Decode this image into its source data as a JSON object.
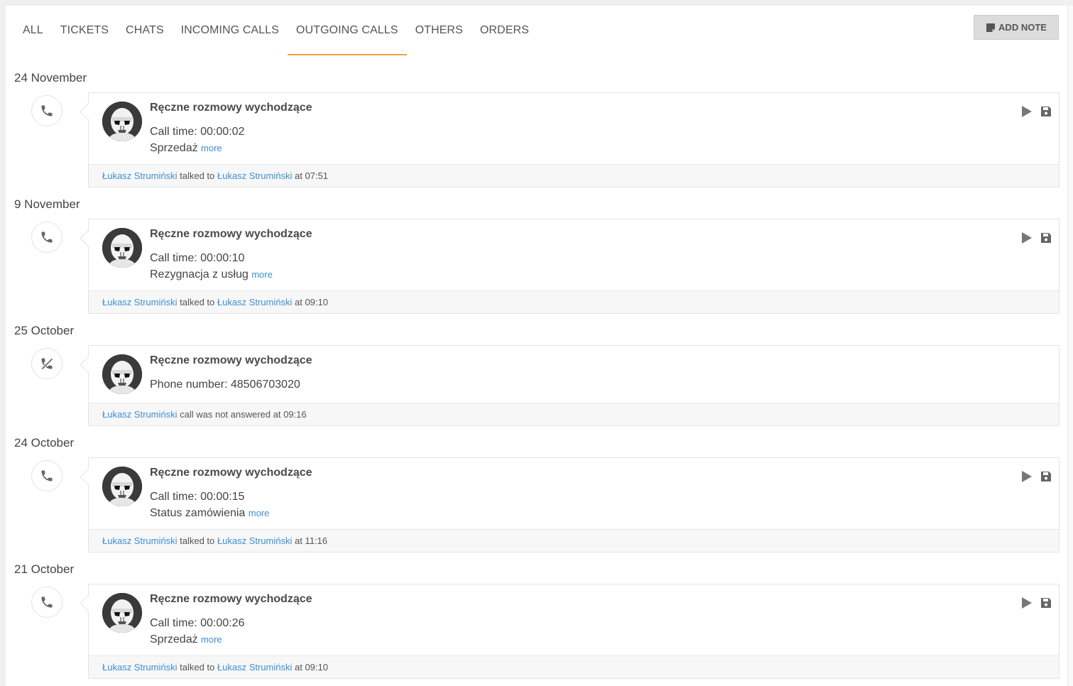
{
  "tabs": [
    {
      "label": "ALL",
      "active": false
    },
    {
      "label": "TICKETS",
      "active": false
    },
    {
      "label": "CHATS",
      "active": false
    },
    {
      "label": "INCOMING CALLS",
      "active": false
    },
    {
      "label": "OUTGOING CALLS",
      "active": true
    },
    {
      "label": "OTHERS",
      "active": false
    },
    {
      "label": "ORDERS",
      "active": false
    }
  ],
  "add_note_label": "ADD NOTE",
  "colors": {
    "accent_underline": "#e8a33d",
    "link": "#3d8fd6",
    "icon_gray": "#666666"
  },
  "entries": [
    {
      "date": "24 November",
      "icon": "phone-icon",
      "title": "Ręczne rozmowy wychodzące",
      "line1": "Call time: 00:00:02",
      "line2": "Sprzedaż",
      "more": "more",
      "answered": true,
      "agent": "Łukasz Strumiński",
      "talked_to": "talked to",
      "customer": "Łukasz Strumiński",
      "at": "at 07:51"
    },
    {
      "date": "9 November",
      "icon": "phone-icon",
      "title": "Ręczne rozmowy wychodzące",
      "line1": "Call time: 00:00:10",
      "line2": "Rezygnacja z usług",
      "more": "more",
      "answered": true,
      "agent": "Łukasz Strumiński",
      "talked_to": "talked to",
      "customer": "Łukasz Strumiński",
      "at": "at 09:10"
    },
    {
      "date": "25 October",
      "icon": "missed-call-icon",
      "title": "Ręczne rozmowy wychodzące",
      "line1": "Phone number: 48506703020",
      "answered": false,
      "agent": "Łukasz Strumiński",
      "status_text": "call was not answered at 09:16"
    },
    {
      "date": "24 October",
      "icon": "phone-icon",
      "title": "Ręczne rozmowy wychodzące",
      "line1": "Call time: 00:00:15",
      "line2": "Status zamówienia",
      "more": "more",
      "answered": true,
      "agent": "Łukasz Strumiński",
      "talked_to": "talked to",
      "customer": "Łukasz Strumiński",
      "at": "at 11:16"
    },
    {
      "date": "21 October",
      "icon": "phone-icon",
      "title": "Ręczne rozmowy wychodzące",
      "line1": "Call time: 00:00:26",
      "line2": "Sprzedaż",
      "more": "more",
      "answered": true,
      "agent": "Łukasz Strumiński",
      "talked_to": "talked to",
      "customer": "Łukasz Strumiński",
      "at": "at 09:10"
    }
  ]
}
